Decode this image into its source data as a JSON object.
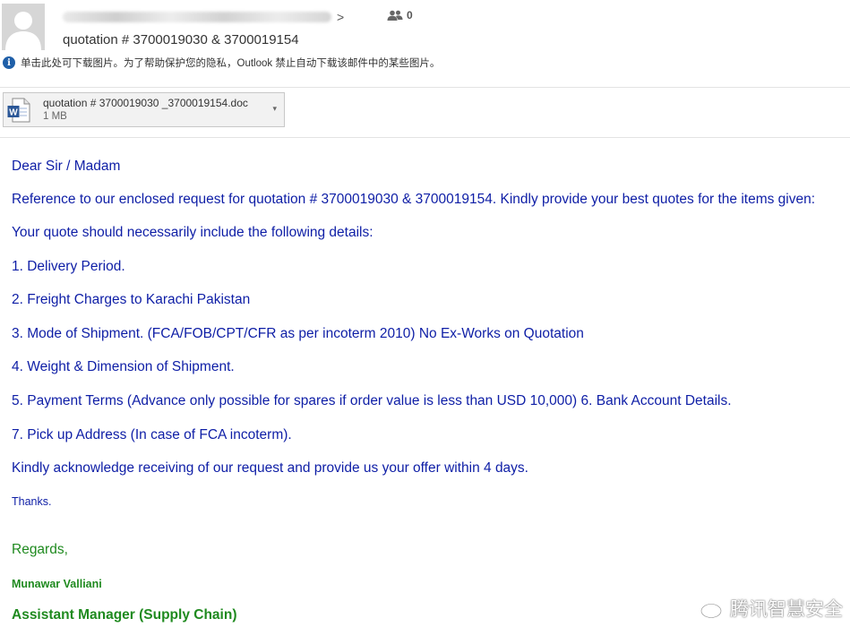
{
  "header": {
    "subject": "quotation # 3700019030 & 3700019154",
    "sender_suffix": ">",
    "recipient_count": "0",
    "info_message": "单击此处可下载图片。为了帮助保护您的隐私，Outlook 禁止自动下载该邮件中的某些图片。"
  },
  "attachment": {
    "filename": "quotation # 3700019030 _3700019154.doc",
    "size": "1 MB",
    "icon": "word-doc-icon"
  },
  "body": {
    "greeting": "Dear Sir / Madam",
    "intro": "Reference to our enclosed request for quotation # 3700019030 & 3700019154. Kindly provide your best quotes for the items given:",
    "details_intro": "Your quote should necessarily include the following details:",
    "items": [
      "1. Delivery Period.",
      "2. Freight Charges to Karachi Pakistan",
      "3. Mode of Shipment. (FCA/FOB/CPT/CFR as per incoterm 2010) No Ex-Works on Quotation",
      "4. Weight & Dimension of Shipment.",
      "5. Payment Terms (Advance only possible for spares if order value is less than USD 10,000) 6. Bank Account Details.",
      "7. Pick up Address (In case of FCA incoterm)."
    ],
    "closing": "Kindly acknowledge receiving of our request and provide us your offer within 4 days.",
    "thanks": "Thanks."
  },
  "signature": {
    "regards": "Regards,",
    "name": "Munawar Valliani",
    "title": "Assistant Manager (Supply Chain)"
  },
  "watermark": {
    "text": "腾讯智慧安全"
  },
  "colors": {
    "body_text": "#0e1ea6",
    "signature": "#1f8a1f",
    "info_icon": "#1f5fa8"
  }
}
